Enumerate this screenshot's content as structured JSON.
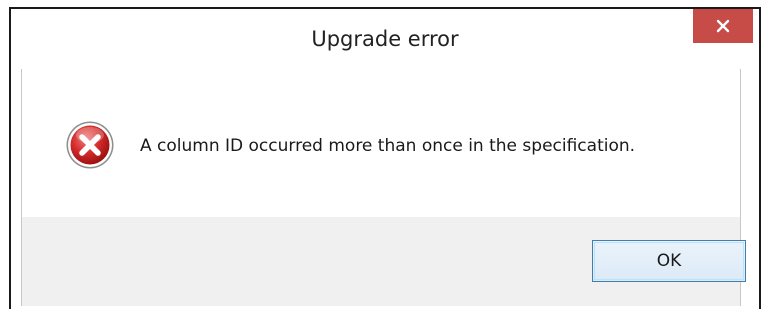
{
  "dialog": {
    "title": "Upgrade error",
    "close_icon": "close-icon",
    "message": "A column ID occurred more than once in the specification.",
    "icon": "error-icon",
    "ok_label": "OK"
  },
  "colors": {
    "close_button": "#c74b46",
    "error_icon_red": "#c8171c",
    "button_area": "#f0f0f0",
    "ok_border": "#3c7fb1"
  }
}
